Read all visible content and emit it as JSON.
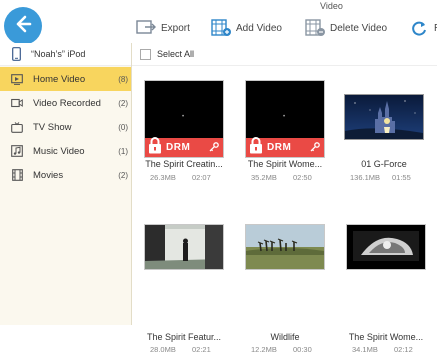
{
  "window": {
    "title": "Video"
  },
  "toolbar": {
    "export_label": "Export",
    "add_video_label": "Add Video",
    "delete_video_label": "Delete Video",
    "refresh_label": "Re"
  },
  "device": {
    "name": "“Noah’s” iPod"
  },
  "sidebar": {
    "items": [
      {
        "label": "Home Video",
        "count": "(8)",
        "icon": "home-video-icon",
        "active": true
      },
      {
        "label": "Video Recorded",
        "count": "(2)",
        "icon": "video-camera-icon"
      },
      {
        "label": "TV Show",
        "count": "(0)",
        "icon": "tv-icon"
      },
      {
        "label": "Music Video",
        "count": "(1)",
        "icon": "music-video-icon"
      },
      {
        "label": "Movies",
        "count": "(2)",
        "icon": "film-icon"
      }
    ]
  },
  "main": {
    "select_all_label": "Select All",
    "drm_label": "DRM",
    "videos": [
      {
        "title": "The Spirit Creatin...",
        "size": "26.3MB",
        "duration": "02:07",
        "drm": true
      },
      {
        "title": "The Spirit Wome...",
        "size": "35.2MB",
        "duration": "02:50",
        "drm": true
      },
      {
        "title": "01 G-Force",
        "size": "136.1MB",
        "duration": "01:55",
        "drm": false
      },
      {
        "title": "The Spirit Featur...",
        "size": "28.0MB",
        "duration": "02:21",
        "drm": false
      },
      {
        "title": "Wildlife",
        "size": "12.2MB",
        "duration": "00:30",
        "drm": false
      },
      {
        "title": "The Spirit Wome...",
        "size": "34.1MB",
        "duration": "02:12",
        "drm": false
      }
    ]
  },
  "colors": {
    "accent_blue": "#3a9ad9",
    "active_yellow": "#f8d55e",
    "drm_red": "#ea4a45",
    "sidebar_bg": "#fbf8ee"
  }
}
